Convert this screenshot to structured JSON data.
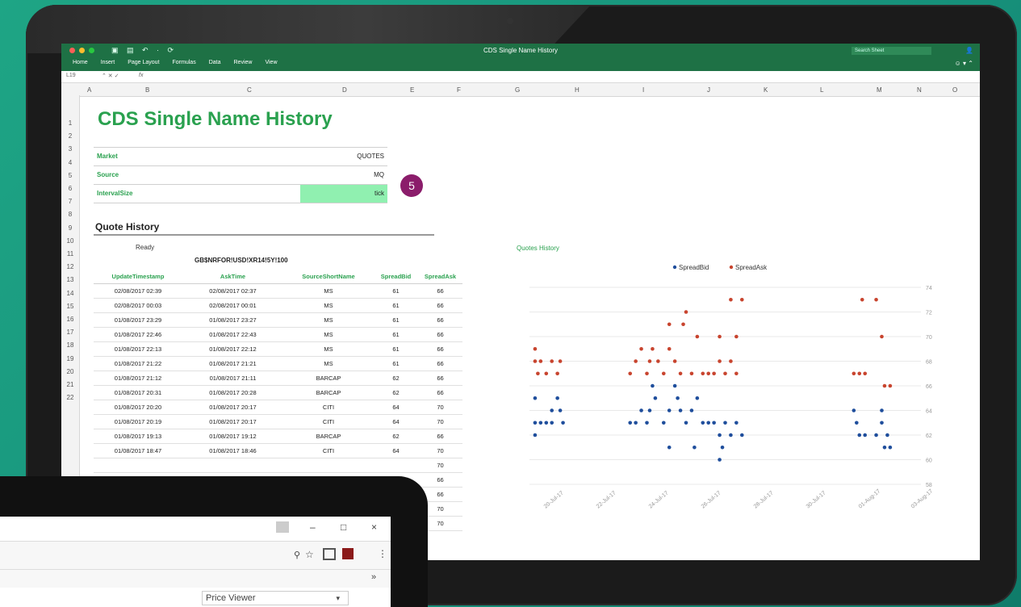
{
  "excel": {
    "window_title": "CDS Single Name History",
    "search_placeholder": "Search Sheet",
    "menu": [
      "Home",
      "Insert",
      "Page Layout",
      "Formulas",
      "Data",
      "Review",
      "View"
    ],
    "name_box": "L19",
    "fx": "fx",
    "columns": [
      "A",
      "B",
      "C",
      "D",
      "E",
      "F",
      "G",
      "H",
      "I",
      "J",
      "K",
      "L",
      "M",
      "N",
      "O"
    ],
    "rows": [
      "1",
      "2",
      "3",
      "4",
      "5",
      "6",
      "7",
      "8",
      "9",
      "10",
      "11",
      "12",
      "13",
      "14",
      "15",
      "16",
      "17",
      "18",
      "19",
      "20",
      "21",
      "22"
    ],
    "sheet_title": "CDS Single Name History",
    "params": [
      {
        "label": "Market",
        "value": "QUOTES"
      },
      {
        "label": "Source",
        "value": "MQ"
      },
      {
        "label": "IntervalSize",
        "value": "tick"
      }
    ],
    "badge": "5",
    "quote_history_title": "Quote History",
    "status": "Ready",
    "ticker": "GB$NRFOR!USD!XR14!5Y!100",
    "table": {
      "headers": [
        "UpdateTimestamp",
        "AskTime",
        "SourceShortName",
        "SpreadBid",
        "SpreadAsk"
      ],
      "rows": [
        [
          "02/08/2017 02:39",
          "02/08/2017 02:37",
          "MS",
          "61",
          "66"
        ],
        [
          "02/08/2017 00:03",
          "02/08/2017 00:01",
          "MS",
          "61",
          "66"
        ],
        [
          "01/08/2017 23:29",
          "01/08/2017 23:27",
          "MS",
          "61",
          "66"
        ],
        [
          "01/08/2017 22:46",
          "01/08/2017 22:43",
          "MS",
          "61",
          "66"
        ],
        [
          "01/08/2017 22:13",
          "01/08/2017 22:12",
          "MS",
          "61",
          "66"
        ],
        [
          "01/08/2017 21:22",
          "01/08/2017 21:21",
          "MS",
          "61",
          "66"
        ],
        [
          "01/08/2017 21:12",
          "01/08/2017 21:11",
          "BARCAP",
          "62",
          "66"
        ],
        [
          "01/08/2017 20:31",
          "01/08/2017 20:28",
          "BARCAP",
          "62",
          "66"
        ],
        [
          "01/08/2017 20:20",
          "01/08/2017 20:17",
          "CITI",
          "64",
          "70"
        ],
        [
          "01/08/2017 20:19",
          "01/08/2017 20:17",
          "CITI",
          "64",
          "70"
        ],
        [
          "01/08/2017 19:13",
          "01/08/2017 19:12",
          "BARCAP",
          "62",
          "66"
        ],
        [
          "01/08/2017 18:47",
          "01/08/2017 18:46",
          "CITI",
          "64",
          "70"
        ]
      ],
      "overflow_values": [
        "70",
        "66",
        "66",
        "70",
        "70"
      ]
    }
  },
  "chart_data": {
    "type": "scatter",
    "title": "Quotes History",
    "legend": [
      "SpreadBid",
      "SpreadAsk"
    ],
    "legend_position": "top",
    "colors": {
      "SpreadBid": "#1f4e9c",
      "SpreadAsk": "#c8442e"
    },
    "ylim": [
      58,
      74
    ],
    "yticks": [
      58,
      60,
      62,
      64,
      66,
      68,
      70,
      72,
      74
    ],
    "x_tick_labels": [
      "20-Jul-17",
      "22-Jul-17",
      "24-Jul-17",
      "26-Jul-17",
      "28-Jul-17",
      "30-Jul-17",
      "01-Aug-17",
      "03-Aug-17"
    ],
    "xlim": [
      0,
      14
    ],
    "series": [
      {
        "name": "SpreadBid",
        "points": [
          [
            0.2,
            62
          ],
          [
            0.2,
            63
          ],
          [
            0.2,
            65
          ],
          [
            0.4,
            63
          ],
          [
            0.6,
            63
          ],
          [
            0.8,
            64
          ],
          [
            0.8,
            63
          ],
          [
            1.0,
            65
          ],
          [
            1.1,
            64
          ],
          [
            1.2,
            63
          ],
          [
            3.6,
            63
          ],
          [
            3.8,
            63
          ],
          [
            4.0,
            64
          ],
          [
            4.2,
            63
          ],
          [
            4.3,
            64
          ],
          [
            4.4,
            66
          ],
          [
            4.5,
            65
          ],
          [
            4.8,
            63
          ],
          [
            5.0,
            64
          ],
          [
            5.0,
            61
          ],
          [
            5.2,
            66
          ],
          [
            5.3,
            65
          ],
          [
            5.4,
            64
          ],
          [
            5.6,
            63
          ],
          [
            5.8,
            64
          ],
          [
            5.9,
            61
          ],
          [
            6.0,
            65
          ],
          [
            6.2,
            63
          ],
          [
            6.4,
            63
          ],
          [
            6.6,
            63
          ],
          [
            6.8,
            62
          ],
          [
            6.8,
            60
          ],
          [
            6.9,
            61
          ],
          [
            7.0,
            63
          ],
          [
            7.2,
            62
          ],
          [
            7.4,
            63
          ],
          [
            7.6,
            62
          ],
          [
            11.6,
            64
          ],
          [
            11.7,
            63
          ],
          [
            11.8,
            62
          ],
          [
            12.0,
            62
          ],
          [
            12.4,
            62
          ],
          [
            12.6,
            64
          ],
          [
            12.6,
            63
          ],
          [
            12.7,
            61
          ],
          [
            12.8,
            62
          ],
          [
            12.9,
            61
          ]
        ]
      },
      {
        "name": "SpreadAsk",
        "points": [
          [
            0.2,
            69
          ],
          [
            0.2,
            68
          ],
          [
            0.3,
            67
          ],
          [
            0.4,
            68
          ],
          [
            0.6,
            67
          ],
          [
            0.8,
            68
          ],
          [
            1.0,
            67
          ],
          [
            1.1,
            68
          ],
          [
            3.6,
            67
          ],
          [
            3.8,
            68
          ],
          [
            4.0,
            69
          ],
          [
            4.2,
            67
          ],
          [
            4.3,
            68
          ],
          [
            4.4,
            69
          ],
          [
            4.6,
            68
          ],
          [
            4.8,
            67
          ],
          [
            5.0,
            69
          ],
          [
            5.0,
            71
          ],
          [
            5.2,
            68
          ],
          [
            5.4,
            67
          ],
          [
            5.5,
            71
          ],
          [
            5.6,
            72
          ],
          [
            5.8,
            67
          ],
          [
            6.0,
            70
          ],
          [
            6.2,
            67
          ],
          [
            6.4,
            67
          ],
          [
            6.6,
            67
          ],
          [
            6.8,
            68
          ],
          [
            6.8,
            70
          ],
          [
            7.0,
            67
          ],
          [
            7.2,
            68
          ],
          [
            7.2,
            73
          ],
          [
            7.4,
            70
          ],
          [
            7.4,
            67
          ],
          [
            7.6,
            73
          ],
          [
            11.6,
            67
          ],
          [
            11.8,
            67
          ],
          [
            11.9,
            73
          ],
          [
            12.0,
            67
          ],
          [
            12.4,
            73
          ],
          [
            12.6,
            70
          ],
          [
            12.7,
            66
          ],
          [
            12.9,
            66
          ]
        ]
      }
    ]
  },
  "browser": {
    "window_controls": [
      "–",
      "□",
      "×"
    ],
    "toolbar_icons": [
      "pin-icon",
      "star-icon",
      "cast-icon",
      "pdf-icon",
      "menu-icon"
    ],
    "bookmarks_chevron": "»",
    "dropdown_value": "Price Viewer"
  }
}
